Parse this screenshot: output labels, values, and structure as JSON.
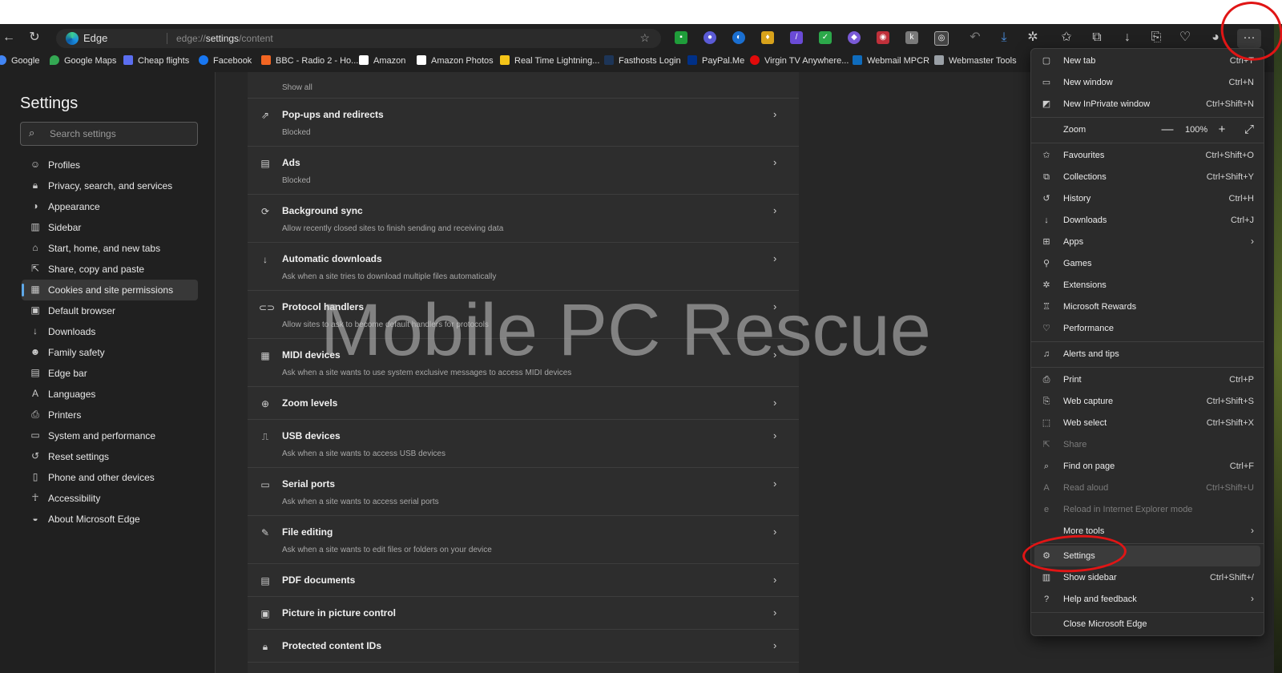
{
  "browser": {
    "edge_label": "Edge",
    "url_prefix": "edge://",
    "url_path": "settings",
    "url_suffix": "/content"
  },
  "bookmarks": [
    {
      "label": "Google",
      "color": "#4285f4"
    },
    {
      "label": "Google Maps",
      "color": "#34a853"
    },
    {
      "label": "Cheap flights",
      "color": "#5b6ef0"
    },
    {
      "label": "Facebook",
      "color": "#1877f2"
    },
    {
      "label": "BBC - Radio 2 - Ho...",
      "color": "#f26522"
    },
    {
      "label": "Amazon",
      "color": "#ffffff"
    },
    {
      "label": "Amazon Photos",
      "color": "#ffffff"
    },
    {
      "label": "Real Time Lightning...",
      "color": "#f5c518"
    },
    {
      "label": "Fasthosts Login",
      "color": "#1d3557"
    },
    {
      "label": "PayPal.Me",
      "color": "#003087"
    },
    {
      "label": "Virgin TV Anywhere...",
      "color": "#e10a0a"
    },
    {
      "label": "Webmail MPCR",
      "color": "#0f6cbd"
    },
    {
      "label": "Webmaster Tools",
      "color": "#9aa0a6"
    }
  ],
  "settings": {
    "title": "Settings",
    "search_placeholder": "Search settings",
    "nav": [
      {
        "label": "Profiles",
        "icon": "profile-icon"
      },
      {
        "label": "Privacy, search, and services",
        "icon": "lock-icon"
      },
      {
        "label": "Appearance",
        "icon": "appearance-icon"
      },
      {
        "label": "Sidebar",
        "icon": "sidebar-icon"
      },
      {
        "label": "Start, home, and new tabs",
        "icon": "home-icon"
      },
      {
        "label": "Share, copy and paste",
        "icon": "share-icon"
      },
      {
        "label": "Cookies and site permissions",
        "icon": "cookies-icon"
      },
      {
        "label": "Default browser",
        "icon": "browser-icon"
      },
      {
        "label": "Downloads",
        "icon": "download-icon"
      },
      {
        "label": "Family safety",
        "icon": "family-icon"
      },
      {
        "label": "Edge bar",
        "icon": "edge-bar-icon"
      },
      {
        "label": "Languages",
        "icon": "language-icon"
      },
      {
        "label": "Printers",
        "icon": "printer-icon"
      },
      {
        "label": "System and performance",
        "icon": "system-icon"
      },
      {
        "label": "Reset settings",
        "icon": "reset-icon"
      },
      {
        "label": "Phone and other devices",
        "icon": "phone-icon"
      },
      {
        "label": "Accessibility",
        "icon": "accessibility-icon"
      },
      {
        "label": "About Microsoft Edge",
        "icon": "edge-icon"
      }
    ],
    "active_nav": "Cookies and site permissions"
  },
  "content": {
    "show_all": "Show all",
    "rows": [
      {
        "title": "Pop-ups and redirects",
        "desc": "Blocked",
        "icon": "popup-icon"
      },
      {
        "title": "Ads",
        "desc": "Blocked",
        "icon": "ads-icon"
      },
      {
        "title": "Background sync",
        "desc": "Allow recently closed sites to finish sending and receiving data",
        "icon": "sync-icon"
      },
      {
        "title": "Automatic downloads",
        "desc": "Ask when a site tries to download multiple files automatically",
        "icon": "download-icon"
      },
      {
        "title": "Protocol handlers",
        "desc": "Allow sites to ask to become default handlers for protocols",
        "icon": "protocol-icon"
      },
      {
        "title": "MIDI devices",
        "desc": "Ask when a site wants to use system exclusive messages to access MIDI devices",
        "icon": "midi-icon"
      },
      {
        "title": "Zoom levels",
        "desc": "",
        "icon": "zoom-icon"
      },
      {
        "title": "USB devices",
        "desc": "Ask when a site wants to access USB devices",
        "icon": "usb-icon"
      },
      {
        "title": "Serial ports",
        "desc": "Ask when a site wants to access serial ports",
        "icon": "serial-icon"
      },
      {
        "title": "File editing",
        "desc": "Ask when a site wants to edit files or folders on your device",
        "icon": "file-edit-icon"
      },
      {
        "title": "PDF documents",
        "desc": "",
        "icon": "pdf-icon"
      },
      {
        "title": "Picture in picture control",
        "desc": "",
        "icon": "pip-icon"
      },
      {
        "title": "Protected content IDs",
        "desc": "",
        "icon": "protected-icon"
      }
    ]
  },
  "watermark": "Mobile PC Rescue",
  "menu": {
    "items": [
      {
        "label": "New tab",
        "shortcut": "Ctrl+T",
        "icon": "new-tab-icon"
      },
      {
        "label": "New window",
        "shortcut": "Ctrl+N",
        "icon": "new-window-icon"
      },
      {
        "label": "New InPrivate window",
        "shortcut": "Ctrl+Shift+N",
        "icon": "inprivate-icon"
      },
      {
        "label": "Favourites",
        "shortcut": "Ctrl+Shift+O",
        "icon": "favourites-icon"
      },
      {
        "label": "Collections",
        "shortcut": "Ctrl+Shift+Y",
        "icon": "collections-icon"
      },
      {
        "label": "History",
        "shortcut": "Ctrl+H",
        "icon": "history-icon"
      },
      {
        "label": "Downloads",
        "shortcut": "Ctrl+J",
        "icon": "downloads-icon"
      },
      {
        "label": "Apps",
        "shortcut": "",
        "icon": "apps-icon",
        "submenu": true
      },
      {
        "label": "Games",
        "shortcut": "",
        "icon": "games-icon"
      },
      {
        "label": "Extensions",
        "shortcut": "",
        "icon": "extensions-icon"
      },
      {
        "label": "Microsoft Rewards",
        "shortcut": "",
        "icon": "rewards-icon"
      },
      {
        "label": "Performance",
        "shortcut": "",
        "icon": "performance-icon"
      },
      {
        "label": "Alerts and tips",
        "shortcut": "",
        "icon": "bell-icon"
      },
      {
        "label": "Print",
        "shortcut": "Ctrl+P",
        "icon": "print-icon"
      },
      {
        "label": "Web capture",
        "shortcut": "Ctrl+Shift+S",
        "icon": "web-capture-icon"
      },
      {
        "label": "Web select",
        "shortcut": "Ctrl+Shift+X",
        "icon": "web-select-icon"
      },
      {
        "label": "Share",
        "shortcut": "",
        "icon": "share-icon",
        "disabled": true
      },
      {
        "label": "Find on page",
        "shortcut": "Ctrl+F",
        "icon": "find-icon"
      },
      {
        "label": "Read aloud",
        "shortcut": "Ctrl+Shift+U",
        "icon": "read-aloud-icon",
        "disabled": true
      },
      {
        "label": "Reload in Internet Explorer mode",
        "shortcut": "",
        "icon": "ie-mode-icon",
        "disabled": true
      },
      {
        "label": "More tools",
        "shortcut": "",
        "icon": "",
        "submenu": true
      },
      {
        "label": "Settings",
        "shortcut": "",
        "icon": "gear-icon",
        "highlighted": true
      },
      {
        "label": "Show sidebar",
        "shortcut": "Ctrl+Shift+/",
        "icon": "sidebar-icon"
      },
      {
        "label": "Help and feedback",
        "shortcut": "",
        "icon": "help-icon",
        "submenu": true
      },
      {
        "label": "Close Microsoft Edge",
        "shortcut": "",
        "icon": ""
      }
    ],
    "zoom": {
      "label": "Zoom",
      "value": "100%",
      "minus": "—",
      "plus": "+",
      "fullscreen": "⤢"
    }
  },
  "colors": {
    "annotation": "#e01515",
    "active_accent": "#5ea8e8",
    "panel_bg": "#2b2b2b"
  }
}
